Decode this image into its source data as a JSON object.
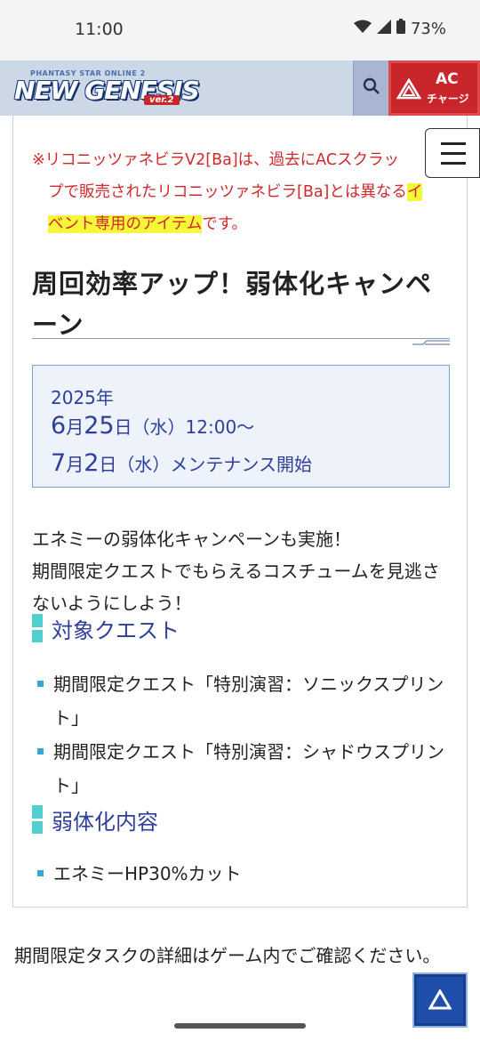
{
  "status_bar": {
    "time": "11:00",
    "battery": "73%",
    "icons": [
      "wifi-icon",
      "signal-icon",
      "battery-icon"
    ]
  },
  "header": {
    "logo": {
      "small_text": "PHANTASY STAR ONLINE 2",
      "main_text": "NEW GENESIS",
      "version_text": "ver.2"
    },
    "search_icon": "search-icon",
    "ac_button": {
      "line1": "AC",
      "line2": "チャージ"
    },
    "menu_icon": "hamburger-menu-icon"
  },
  "notice": {
    "line1": "※リコニッツァネビラV2[Ba]は、過去にACスクラッ",
    "line2_a": "プで販売されたリコニッツァネビラ[Ba]とは異なる",
    "line2_hl": "イ",
    "line3_hl": "ベント専用のアイテム",
    "line3_b": "です。"
  },
  "section": {
    "title": "周回効率アップ！弱体化キャンペーン",
    "date": {
      "year": "2025年",
      "start_month": "6",
      "start_m_unit": "月",
      "start_day": "25",
      "start_d_unit": "日",
      "start_rest": "（水）12:00～",
      "end_month": "7",
      "end_m_unit": "月",
      "end_day": "2",
      "end_d_unit": "日",
      "end_rest": "（水）メンテナンス開始"
    },
    "description_line1": "エネミーの弱体化キャンペーンも実施！",
    "description_line2": "期間限定クエストでもらえるコスチュームを見逃さないようにしよう！",
    "target_heading": "対象クエスト",
    "target_quests": [
      "期間限定クエスト「特別演習：ソニックスプリント」",
      "期間限定クエスト「特別演習：シャドウスプリント」"
    ],
    "weaken_heading": "弱体化内容",
    "weaken_items": [
      "エネミーHP30%カット"
    ]
  },
  "footer_text": "期間限定タスクの詳細はゲーム内でご確認ください。",
  "back_to_top_icon": "arrow-up-icon"
}
